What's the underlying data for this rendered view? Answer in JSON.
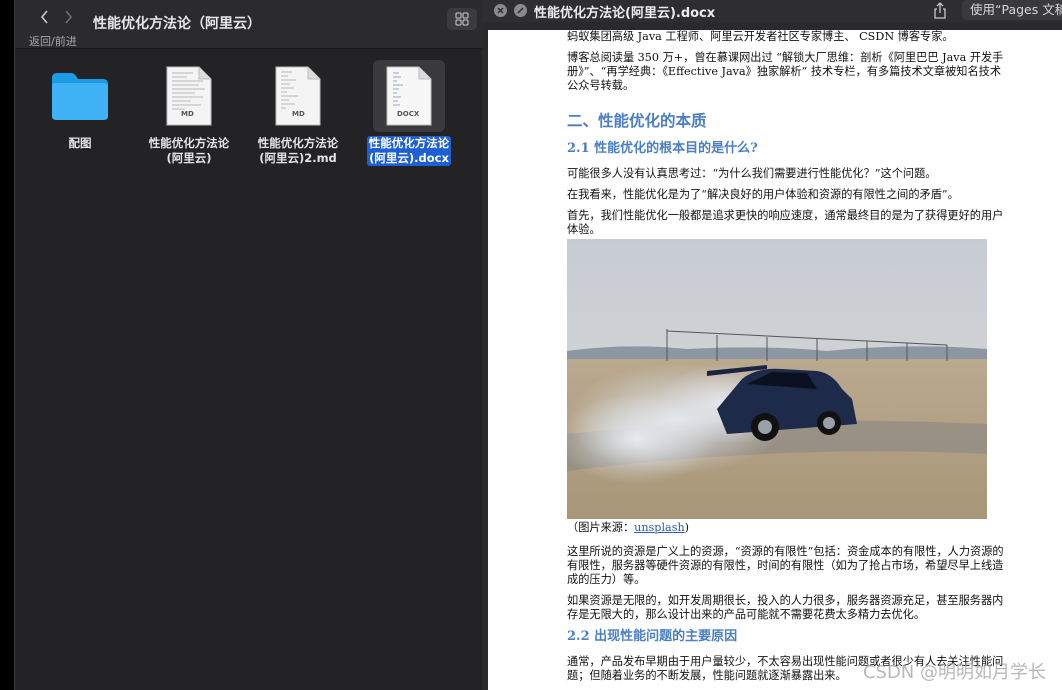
{
  "finder": {
    "title": "性能优化方法论（阿里云）",
    "nav_label": "返回/前进",
    "files": [
      {
        "name_line1": "配图",
        "name_line2": "",
        "type": "folder",
        "badge": ""
      },
      {
        "name_line1": "性能优化方法论",
        "name_line2": "(阿里云)",
        "type": "md",
        "badge": "MD"
      },
      {
        "name_line1": "性能优化方法论",
        "name_line2": "(阿里云)2.md",
        "type": "md",
        "badge": "MD"
      },
      {
        "name_line1": "性能优化方法论",
        "name_line2": "(阿里云).docx",
        "type": "docx",
        "badge": "DOCX",
        "selected": true
      }
    ]
  },
  "quicklook": {
    "title": "性能优化方法论(阿里云).docx",
    "open_with": "使用“Pages 文稿”打开"
  },
  "doc": {
    "p_intro1": "蚂蚁集团高级 Java 工程师、阿里云开发者社区专家博主、 CSDN 博客专家。",
    "p_intro2": "博客总阅读量 350 万+，曾在慕课网出过 “解锁大厂思维：剖析《阿里巴巴 Java 开发手册》”、“再学经典：《Effective Java》独家解析” 技术专栏，有多篇技术文章被知名技术公众号转载。",
    "h2": "二、性能优化的本质",
    "h3_1": "2.1 性能优化的根本目的是什么?",
    "p1": "可能很多人没有认真思考过：“为什么我们需要进行性能优化？”这个问题。",
    "p2": "在我看来，性能优化是为了“解决良好的用户体验和资源的有限性之间的矛盾”。",
    "p3": "首先，我们性能优化一般都是追求更快的响应速度，通常最终目的是为了获得更好的用户体验。",
    "caption_prefix": "（图片来源：",
    "caption_link": "unsplash",
    "caption_suffix": ")",
    "p4": "这里所说的资源是广义上的资源，“资源的有限性”包括：资金成本的有限性，人力资源的有限性，服务器等硬件资源的有限性，时间的有限性（如为了抢占市场，希望尽早上线造成的压力）等。",
    "p5": "如果资源是无限的，如开发周期很长，投入的人力很多，服务器资源充足，甚至服务器内存是无限大的，那么设计出来的产品可能就不需要花费太多精力去优化。",
    "h3_2": "2.2 出现性能问题的主要原因",
    "p6": "通常，产品发布早期由于用户量较少，不太容易出现性能问题或者很少有人去关注性能问题；但随着业务的不断发展，性能问题就逐渐暴露出来。",
    "watermark": "CSDN @明明如月学长"
  }
}
